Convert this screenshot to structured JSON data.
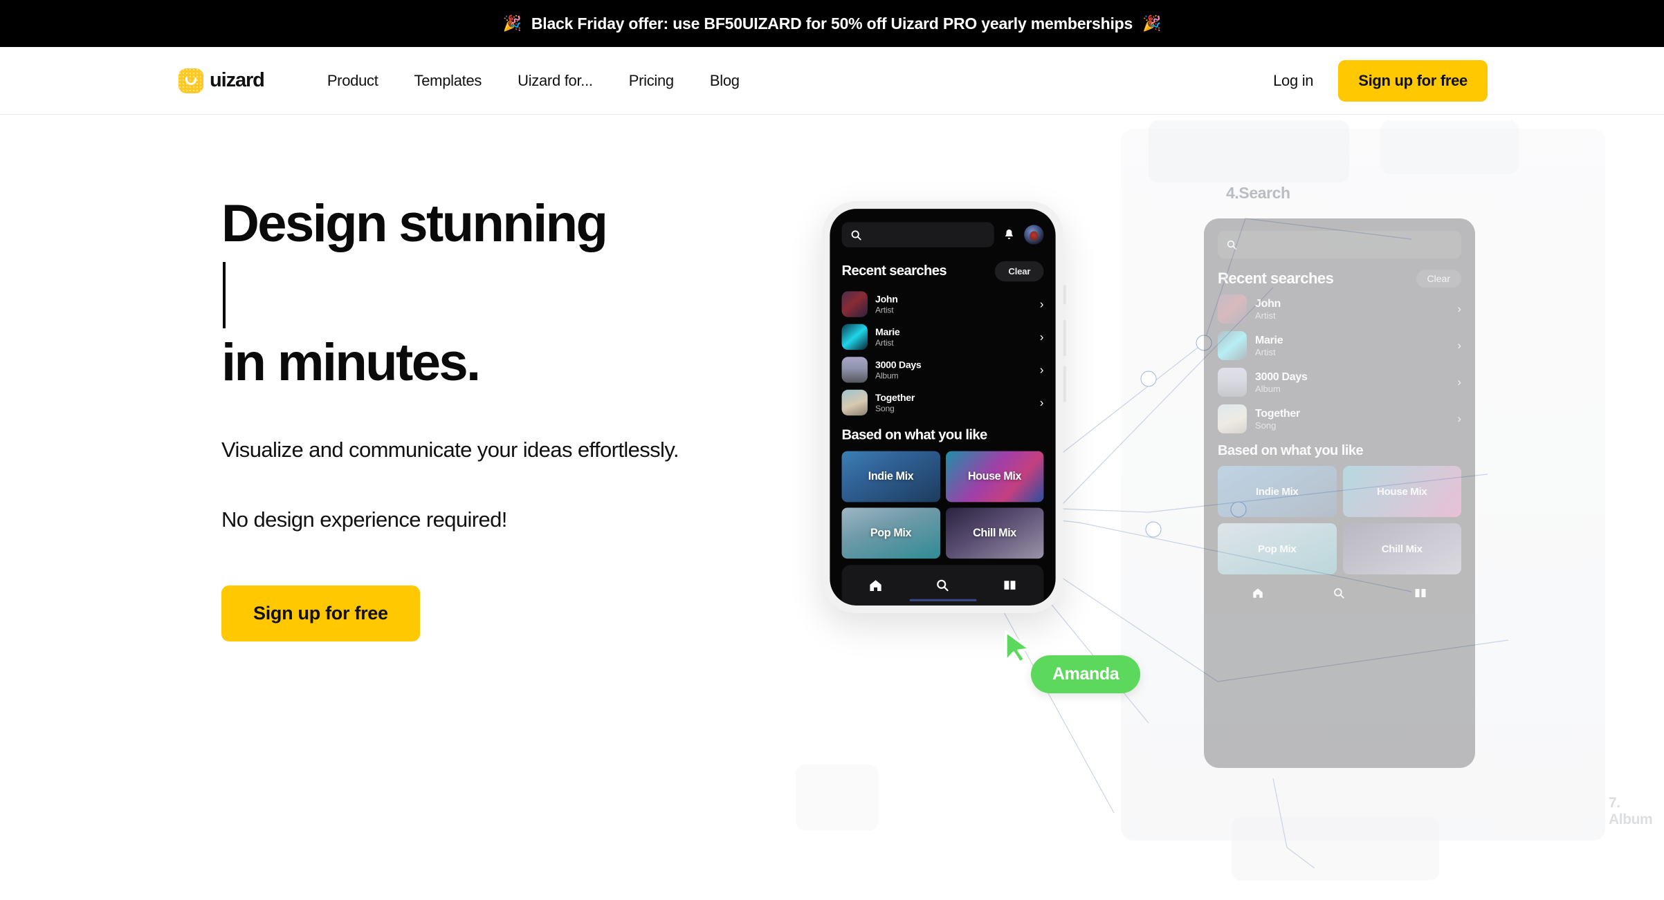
{
  "promo": {
    "emoji_left": "🎉",
    "emoji_right": "🎉",
    "text": "Black Friday offer: use BF50UIZARD for 50% off Uizard PRO yearly memberships"
  },
  "nav": {
    "brand_name": "uizard",
    "links": [
      {
        "label": "Product"
      },
      {
        "label": "Templates"
      },
      {
        "label": "Uizard for..."
      },
      {
        "label": "Pricing"
      },
      {
        "label": "Blog"
      }
    ],
    "login_label": "Log in",
    "signup_label": "Sign up for free"
  },
  "hero": {
    "headline_line1": "Design stunning",
    "headline_line2": "",
    "headline_line3": "in minutes.",
    "subcopy_1": "Visualize and communicate your ideas effortlessly.",
    "subcopy_2": "No design experience required!",
    "cta_label": "Sign up for free"
  },
  "phone": {
    "search_placeholder": "",
    "search_icon": "search-icon",
    "bell_icon": "bell-icon",
    "avatar_icon": "user-avatar",
    "recent_title": "Recent searches",
    "clear_label": "Clear",
    "recent_items": [
      {
        "name": "John",
        "type": "Artist",
        "chevron": "›"
      },
      {
        "name": "Marie",
        "type": "Artist",
        "chevron": "›"
      },
      {
        "name": "3000 Days",
        "type": "Album",
        "chevron": "›"
      },
      {
        "name": "Together",
        "type": "Song",
        "chevron": "›"
      }
    ],
    "recommend_title": "Based on what you like",
    "mixes": [
      {
        "label": "Indie Mix"
      },
      {
        "label": "House Mix"
      },
      {
        "label": "Pop Mix"
      },
      {
        "label": "Chill Mix"
      }
    ],
    "bottom_nav": [
      {
        "icon": "home-icon"
      },
      {
        "icon": "search-icon"
      },
      {
        "icon": "book-icon"
      }
    ]
  },
  "cursor": {
    "label": "Amanda",
    "color": "#5CD95C"
  },
  "canvas": {
    "screen_label_1": "4.Search",
    "screen_label_2": "7. Album"
  },
  "colors": {
    "brand_yellow": "#FFC800",
    "banner_bg": "#000000",
    "cursor_green": "#5CD95C",
    "text_dark": "#0A0A0A"
  }
}
